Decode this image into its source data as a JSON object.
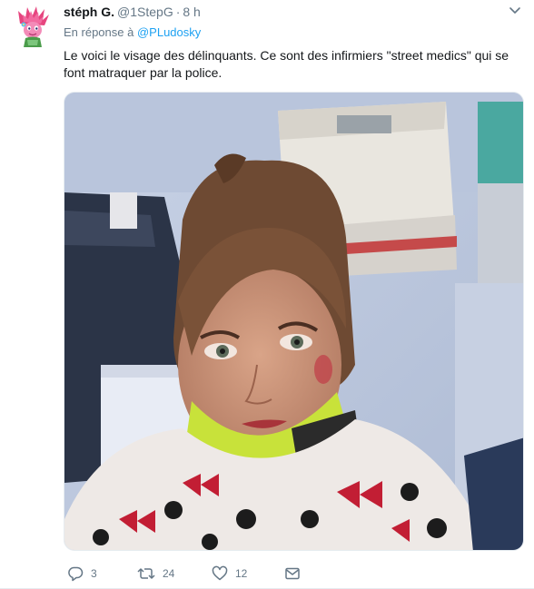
{
  "author": {
    "display_name": "stéph G.",
    "handle": "@1StepG",
    "separator": "·",
    "time": "8 h"
  },
  "reply_context": {
    "prefix": "En réponse à",
    "mention": "@PLudosky"
  },
  "tweet": {
    "text": "Le voici le visage des délinquants. Ce sont des infirmiers \"street medics\" qui se font matraquer par la police."
  },
  "actions": {
    "reply_count": "3",
    "retweet_count": "24",
    "like_count": "12"
  },
  "icons": {
    "avatar": "troll-doll-avatar",
    "menu": "chevron-down-icon",
    "reply": "reply-icon",
    "retweet": "retweet-icon",
    "like": "heart-icon",
    "message": "envelope-icon"
  },
  "colors": {
    "text": "#14171a",
    "secondary": "#657786",
    "link": "#1da1f2",
    "border": "#e6ecf0"
  }
}
